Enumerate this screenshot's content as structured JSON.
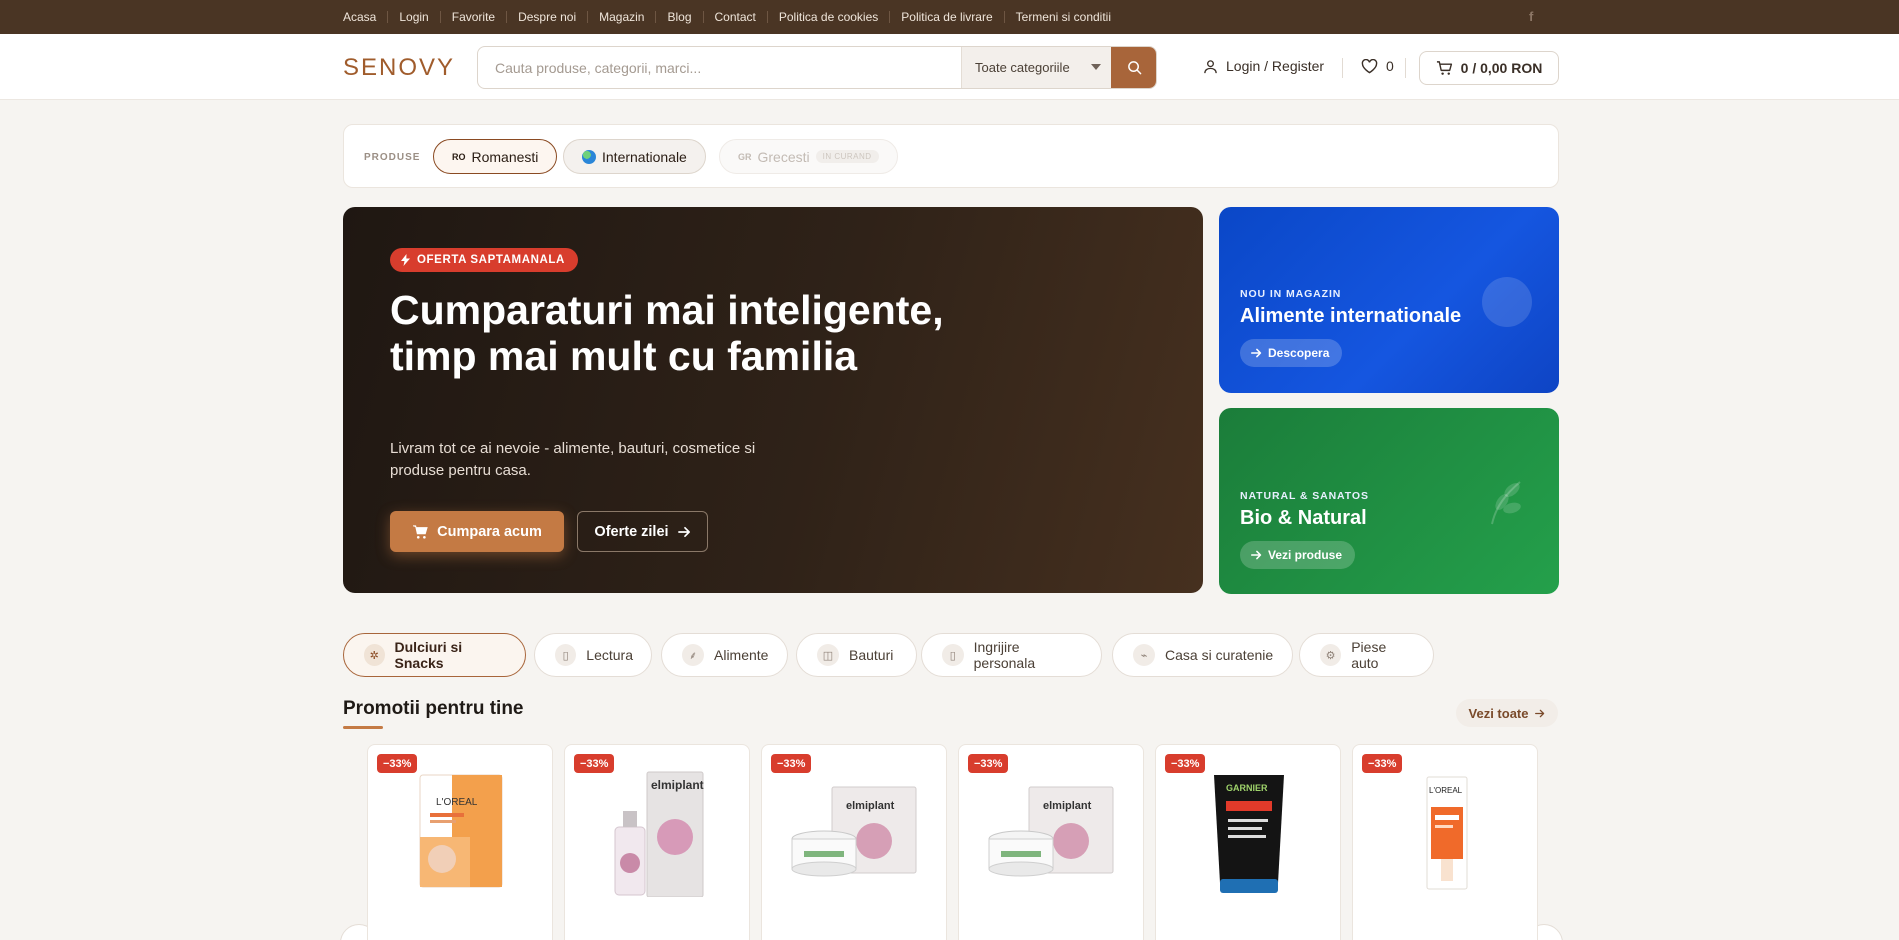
{
  "topnav": [
    "Acasa",
    "Login",
    "Favorite",
    "Despre noi",
    "Magazin",
    "Blog",
    "Contact",
    "Politica de cookies",
    "Politica de livrare",
    "Termeni si conditii"
  ],
  "social_icon": "facebook-icon",
  "header": {
    "logo": "SENOVY",
    "search_placeholder": "Cauta produse, categorii, marci...",
    "category_select": "Toate categoriile",
    "login_label": "Login / Register",
    "favorites_count": "0",
    "cart_label": "0 / 0,00 RON"
  },
  "origin": {
    "label": "PRODUSE",
    "options": [
      {
        "code": "RO",
        "label": "Romanesti",
        "active": true
      },
      {
        "code": "",
        "label": "Internationale",
        "active": false
      },
      {
        "code": "GR",
        "label": "Grecesti",
        "badge": "IN CURAND",
        "disabled": true
      }
    ]
  },
  "hero": {
    "badge": "OFERTA SAPTAMANALA",
    "title": "Cumparaturi mai inteligente, timp mai mult cu familia",
    "subtitle": "Livram tot ce ai nevoie - alimente, bauturi, cosmetice si produse pentru casa.",
    "primary_button": "Cumpara acum",
    "secondary_button": "Oferte zilei"
  },
  "side_promos": [
    {
      "kicker": "NOU IN MAGAZIN",
      "title": "Alimente internationale",
      "button": "Descopera",
      "color": "#1251d9"
    },
    {
      "kicker": "NATURAL & SANATOS",
      "title": "Bio & Natural",
      "button": "Vezi produse",
      "color": "#1f8e42"
    }
  ],
  "categories": [
    {
      "label": "Dulciuri si Snacks",
      "icon": "candy-icon",
      "active": true
    },
    {
      "label": "Lectura",
      "icon": "book-icon"
    },
    {
      "label": "Alimente",
      "icon": "wheat-icon"
    },
    {
      "label": "Bauturi",
      "icon": "cup-icon"
    },
    {
      "label": "Ingrijire personala",
      "icon": "bottle-icon"
    },
    {
      "label": "Casa si curatenie",
      "icon": "spray-icon"
    },
    {
      "label": "Piese auto",
      "icon": "gear-icon"
    }
  ],
  "promotions": {
    "title": "Promotii pentru tine",
    "see_all": "Vezi toate",
    "products": [
      {
        "discount": "−33%",
        "brand": "L'OREAL",
        "image": "serum-mask"
      },
      {
        "discount": "−33%",
        "brand": "elmiplant",
        "image": "serum-box"
      },
      {
        "discount": "−33%",
        "brand": "elmiplant",
        "image": "cream-jar-box"
      },
      {
        "discount": "−33%",
        "brand": "elmiplant",
        "image": "cream-jar-box"
      },
      {
        "discount": "−33%",
        "brand": "GARNIER",
        "image": "scrub-tube"
      },
      {
        "discount": "−33%",
        "brand": "L'OREAL",
        "image": "serum-bottle"
      }
    ]
  },
  "colors": {
    "topbar": "#4a3524",
    "accent": "#a8653a",
    "badge_red": "#d83d2d"
  }
}
